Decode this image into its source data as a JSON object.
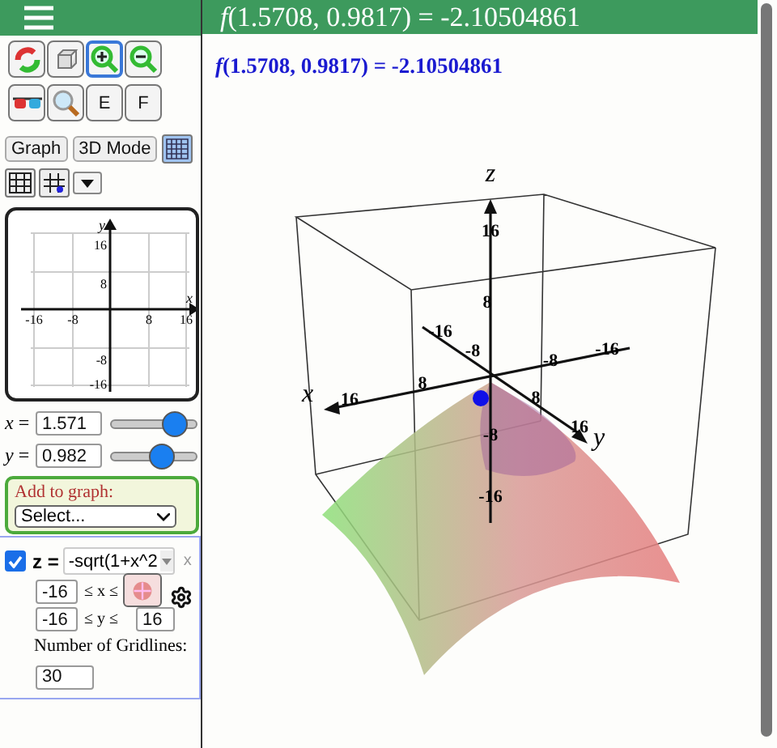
{
  "title": "*f*(1.5708, 0.9817) = -2.10504861",
  "readout": "*f*(1.5708, 0.9817) = -2.10504861",
  "tools": [
    {
      "kind": "rotate",
      "selected": false
    },
    {
      "kind": "cube",
      "selected": false
    },
    {
      "kind": "zoom_in",
      "selected": true
    },
    {
      "kind": "zoom_out",
      "selected": false
    },
    {
      "kind": "glasses",
      "selected": false
    },
    {
      "kind": "magnifier",
      "selected": false
    },
    {
      "kind": "text",
      "label": "E",
      "selected": false
    },
    {
      "kind": "text",
      "label": "F",
      "selected": false
    }
  ],
  "mode_buttons": [
    "Graph",
    "3D Mode"
  ],
  "grid_button": {
    "selected": true
  },
  "mini_graph": {
    "x_label": "x",
    "y_label": "y",
    "x_ticks": [
      "-16",
      "-8",
      "8",
      "16"
    ],
    "y_ticks": [
      "16",
      "8",
      "-8",
      "-16"
    ]
  },
  "variables": [
    {
      "label": "*x* =",
      "value": "1.571",
      "level": 0.84
    },
    {
      "label": "*y* =",
      "value": "0.982",
      "level": 0.62
    }
  ],
  "add_to_graph": {
    "label": "Add to graph:",
    "select": "Select..."
  },
  "functions": [
    {
      "checked": true,
      "lhs": "z =",
      "expression": "-sqrt(1+x^2",
      "close": "x",
      "x_min": "-16",
      "x_rel": "≤ x ≤",
      "y_min": "-16",
      "y_rel": "≤ y ≤",
      "y_max": "16",
      "gridlines_label": "Number of Gridlines:",
      "gridlines": "30"
    }
  ],
  "plot3d": {
    "axis_labels": [
      "x",
      "y",
      "z"
    ],
    "x_ticks": [
      "16",
      "8",
      "-8",
      "-16"
    ],
    "y_ticks": [
      "-16",
      "-8",
      "8",
      "16"
    ],
    "z_ticks": [
      "16",
      "8",
      "-8",
      "-16"
    ]
  }
}
